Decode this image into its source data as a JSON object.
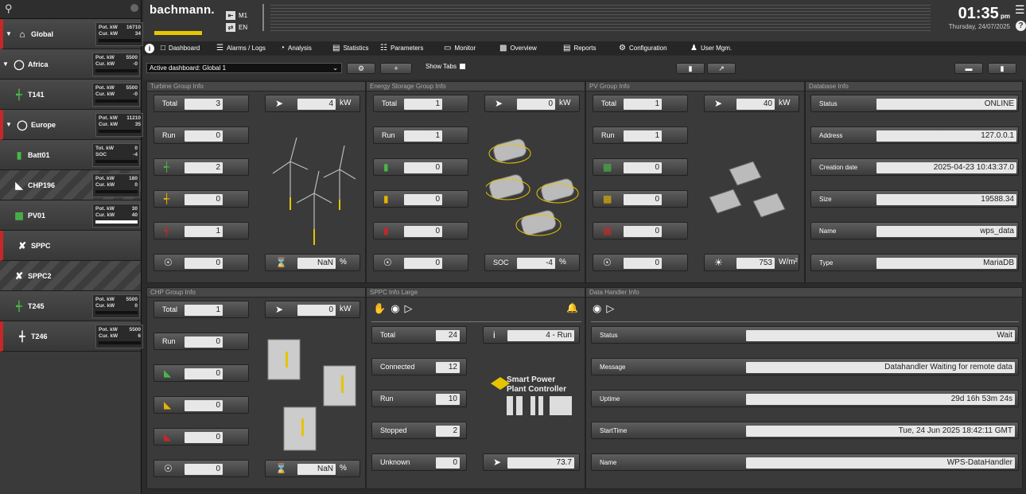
{
  "sidebar": {
    "nodes": [
      {
        "name": "Global",
        "icon": "home-icon",
        "color": "#ffffff",
        "expand": true,
        "alarm": true,
        "l1": "Pot. kW",
        "v1": "16710",
        "l2": "Cur. kW",
        "v2": "34",
        "bar": 0.0
      },
      {
        "name": "Africa",
        "icon": "globe-icon",
        "color": "#ffffff",
        "expand": true,
        "alarm": false,
        "l1": "Pot. kW",
        "v1": "5500",
        "l2": "Cur. kW",
        "v2": "-0",
        "bar": 0.0
      },
      {
        "name": "T141",
        "icon": "turbine-icon",
        "color": "#48b748",
        "expand": false,
        "alarm": false,
        "l1": "Pot. kW",
        "v1": "5500",
        "l2": "Cur. kW",
        "v2": "-0",
        "bar": 0.0
      },
      {
        "name": "Europe",
        "icon": "globe-icon",
        "color": "#ffffff",
        "expand": true,
        "alarm": true,
        "l1": "Pot. kW",
        "v1": "11210",
        "l2": "Cur. kW",
        "v2": "35",
        "bar": 0.0
      },
      {
        "name": "Batt01",
        "icon": "battery-icon",
        "color": "#48b748",
        "expand": false,
        "alarm": false,
        "l1": "Tot. kW",
        "v1": "0",
        "l2": "SOC",
        "v2": "-4",
        "bar": 0.0
      },
      {
        "name": "CHP196",
        "icon": "factory-icon",
        "color": "#ffffff",
        "expand": false,
        "alarm": false,
        "hatch": true,
        "l1": "Pot. kW",
        "v1": "180",
        "l2": "Cur. kW",
        "v2": "0",
        "bar": 0.0
      },
      {
        "name": "PV01",
        "icon": "solar-icon",
        "color": "#48b748",
        "expand": false,
        "alarm": false,
        "l1": "Pot. kW",
        "v1": "30",
        "l2": "Cur. kW",
        "v2": "40",
        "bar": 1.0
      },
      {
        "name": "SPPC",
        "icon": "controller-icon",
        "color": "#ffffff",
        "expand": false,
        "alarm": true
      },
      {
        "name": "SPPC2",
        "icon": "controller-icon",
        "color": "#ffffff",
        "expand": false,
        "alarm": false,
        "hatch": true
      },
      {
        "name": "T245",
        "icon": "turbine-icon",
        "color": "#48b748",
        "expand": false,
        "alarm": false,
        "l1": "Pot. kW",
        "v1": "5500",
        "l2": "Cur. kW",
        "v2": "0",
        "bar": 0.0
      },
      {
        "name": "T246",
        "icon": "turbine-icon",
        "color": "#ffffff",
        "expand": false,
        "alarm": true,
        "l1": "Pot. kW",
        "v1": "5500",
        "l2": "Cur. kW",
        "v2": "6",
        "bar": 0.0
      }
    ]
  },
  "header": {
    "logo": "bachmann.",
    "pref1": "M1",
    "pref2": "EN",
    "time": "01:35",
    "ampm": "pm",
    "date": "Thursday, 24/07/2025"
  },
  "tabs": [
    "Dashboard",
    "Alarms / Logs",
    "Analysis",
    "Statistics",
    "Parameters",
    "Monitor",
    "Overview",
    "Reports",
    "Configuration",
    "User Mgm."
  ],
  "tab_icons": [
    "page-icon",
    "alarm-icon",
    "pie-icon",
    "chart-icon",
    "parameters-icon",
    "monitor-icon",
    "overview-icon",
    "report-icon",
    "gear-icon",
    "user-icon"
  ],
  "toolbar": {
    "dashboard": "Active dashboard: Global 1",
    "show_tabs": "Show Tabs"
  },
  "turbine": {
    "title": "Turbine Group Info",
    "total_label": "Total",
    "total": "3",
    "power": "4",
    "power_unit": "kW",
    "run_label": "Run",
    "run": "0",
    "green": "2",
    "yellow": "0",
    "red": "1",
    "gauge": "0",
    "pct": "NaN",
    "pct_unit": "%"
  },
  "storage": {
    "title": "Energy Storage Group Info",
    "total_label": "Total",
    "total": "1",
    "power": "0",
    "power_unit": "kW",
    "run_label": "Run",
    "run": "1",
    "green": "0",
    "yellow": "0",
    "red": "0",
    "gauge": "0",
    "soc_label": "SOC",
    "soc": "-4",
    "soc_unit": "%"
  },
  "pv": {
    "title": "PV Group Info",
    "total_label": "Total",
    "total": "1",
    "power": "40",
    "power_unit": "kW",
    "run_label": "Run",
    "run": "1",
    "green": "0",
    "yellow": "0",
    "red": "0",
    "gauge": "0",
    "irr": "753",
    "irr_unit": "W/m²"
  },
  "database": {
    "title": "Database Info",
    "rows": [
      {
        "label": "Status",
        "value": "ONLINE"
      },
      {
        "label": "Address",
        "value": "127.0.0.1"
      },
      {
        "label": "Creation date",
        "value": "2025-04-23 10:43:37.0"
      },
      {
        "label": "Size",
        "value": "19588.34"
      },
      {
        "label": "Name",
        "value": "wps_data"
      },
      {
        "label": "Type",
        "value": "MariaDB"
      }
    ]
  },
  "chp": {
    "title": "CHP Group Info",
    "total_label": "Total",
    "total": "1",
    "power": "0",
    "power_unit": "kW",
    "run_label": "Run",
    "run": "0",
    "green": "0",
    "yellow": "0",
    "red": "0",
    "gauge": "0",
    "pct": "NaN",
    "pct_unit": "%"
  },
  "sppc": {
    "title": "SPPC Info Large",
    "rows": [
      {
        "label": "Total",
        "value": "24"
      },
      {
        "label": "Connected",
        "value": "12"
      },
      {
        "label": "Run",
        "value": "10"
      },
      {
        "label": "Stopped",
        "value": "2"
      },
      {
        "label": "Unknown",
        "value": "0"
      }
    ],
    "state": "4 - Run",
    "power": "73.7",
    "logo1": "Smart Power",
    "logo2": "Plant Controller"
  },
  "handler": {
    "title": "Data Handler Info",
    "rows": [
      {
        "label": "Status",
        "value": "Wait"
      },
      {
        "label": "Message",
        "value": "Datahandler Waiting for remote data"
      },
      {
        "label": "Uptime",
        "value": "29d 16h 53m 24s"
      },
      {
        "label": "StartTime",
        "value": "Tue, 24 Jun 2025 18:42:11 GMT"
      },
      {
        "label": "Name",
        "value": "WPS-DataHandler"
      }
    ]
  }
}
